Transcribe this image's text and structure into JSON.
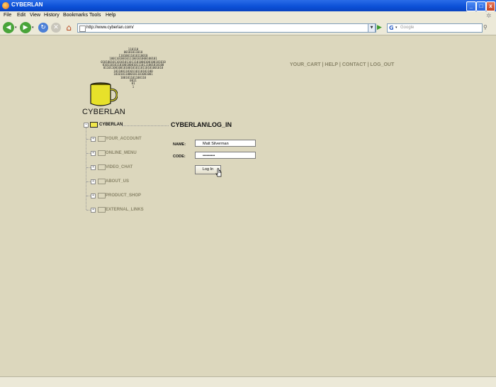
{
  "window": {
    "title": "CYBERLAN",
    "minimize_glyph": "_",
    "maximize_glyph": "□",
    "close_glyph": "x"
  },
  "menu": {
    "items": [
      "File",
      "Edit",
      "View",
      "History",
      "Bookmarks",
      "Tools",
      "Help"
    ]
  },
  "toolbar": {
    "url": "http://www.cyberlan.com/",
    "search_placeholder": "Google"
  },
  "site": {
    "brand": "CYBERLAN",
    "binary_art": "110110\n00101011010\n11010011010110010\n1001101001011100101000100101\n01010010110101011011101000100100101010\n010110101101001000101110111001010100\n01101100100101001010110110101001010\n10110011010110110101100\n10101011000101101001001\n100101101100110\n0011\n01\n1",
    "top_links": [
      "YOUR_CART",
      "HELP",
      "CONTACT",
      "LOG_OUT"
    ],
    "tree": {
      "root": "CYBERLAN",
      "items": [
        "YOUR_ACCOUNT",
        "ONLINE_MENU",
        "VIDEO_CHAT",
        "ABOUT_US",
        "PRODUCT_SHOP",
        "EXTERNAL_LINKS"
      ]
    },
    "page_heading": "CYBERLAN\\LOG_IN",
    "form": {
      "name_label": "NAME:",
      "name_value": "Matt Silverman",
      "code_label": "CODE:",
      "code_value": "•••••••••",
      "login_label": "Log In"
    }
  },
  "colors": {
    "page_bg": "#dcd7bd",
    "muted_text": "#8a8569",
    "titlebar": "#0b4fd6"
  }
}
